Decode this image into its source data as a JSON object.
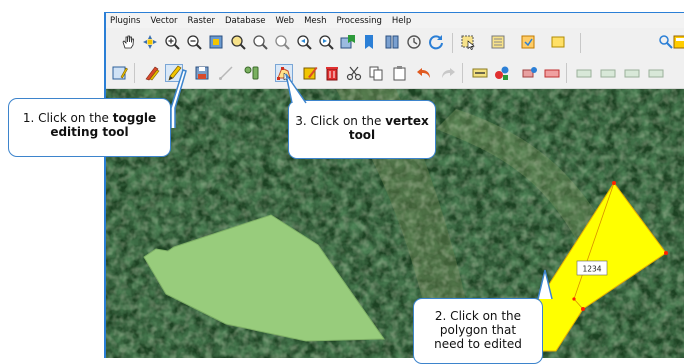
{
  "menu": {
    "items": [
      "Plugins",
      "Vector",
      "Raster",
      "Database",
      "Web",
      "Mesh",
      "Processing",
      "Help"
    ]
  },
  "toolbar1": {
    "icons": [
      "pan-hand-icon",
      "pan-to-selection-icon",
      "zoom-in-icon",
      "zoom-out-icon",
      "zoom-full-icon",
      "zoom-to-selection-icon",
      "zoom-to-layer-icon",
      "zoom-native-icon",
      "zoom-last-icon",
      "zoom-next-icon",
      "new-bookmark-icon",
      "show-bookmarks-icon",
      "temporal-controller-icon",
      "refresh-icon",
      "select-features-icon",
      "deselect-icon",
      "attribute-table-icon",
      "field-calculator-icon",
      "identify-icon",
      "statistics-icon"
    ]
  },
  "toolbar2": {
    "icons": [
      "digitizing-icon",
      "current-edits-icon",
      "toggle-editing-icon",
      "save-edits-icon",
      "add-feature-icon",
      "digitize-with-segment-icon",
      "vertex-tool-icon",
      "modify-attributes-icon",
      "delete-selected-icon",
      "cut-features-icon",
      "copy-features-icon",
      "paste-features-icon",
      "undo-icon",
      "redo-icon",
      "label-toolbar-icon",
      "diagram-icon",
      "pin-labels-icon",
      "highlight-labels-icon",
      "show-hide-labels-icon",
      "move-label-icon",
      "rotate-label-icon",
      "change-label-icon"
    ]
  },
  "map": {
    "feature_label": "1234",
    "colors": {
      "green_polygon": "#98cc7c",
      "yellow_polygon": "#ffff00",
      "forest_dark": "#163a1c",
      "forest_mid": "#2f5a30",
      "vertex": "#ff2200"
    }
  },
  "callouts": {
    "step1": {
      "prefix": "1. Click on the ",
      "bold": "toggle editing tool"
    },
    "step2": {
      "text": "2. Click on the polygon that need to edited"
    },
    "step3": {
      "prefix": "3. Click on the ",
      "bold": "vertex tool"
    }
  },
  "callout_border_color": "#3d84cc"
}
